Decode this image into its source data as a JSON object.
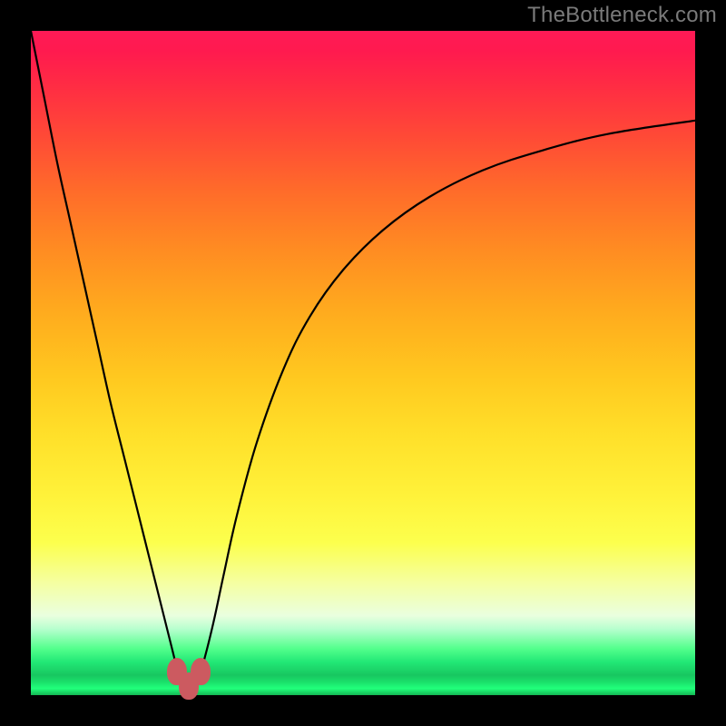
{
  "watermark": "TheBottleneck.com",
  "colors": {
    "curve": "#000000",
    "blob": "#cc5a60",
    "frame": "#000000"
  },
  "chart_data": {
    "type": "line",
    "title": "",
    "xlabel": "",
    "ylabel": "",
    "xlim": [
      0,
      100
    ],
    "ylim": [
      0,
      100
    ],
    "grid": false,
    "series": [
      {
        "name": "curve",
        "x": [
          0,
          2,
          4,
          6,
          8,
          10,
          12,
          14,
          16,
          18,
          20,
          21.5,
          22.5,
          23.5,
          25,
          26,
          27.5,
          29,
          31,
          34,
          38,
          42,
          47,
          53,
          60,
          68,
          77,
          87,
          100
        ],
        "y": [
          100,
          90,
          80,
          71,
          62,
          53,
          44,
          36,
          28,
          20,
          12,
          6,
          2,
          1,
          2,
          5,
          11,
          18,
          27,
          38,
          49,
          57,
          64,
          70,
          75,
          79,
          82,
          84.5,
          86.5
        ]
      }
    ],
    "annotations": [
      {
        "type": "blob",
        "x": 22.0,
        "y": 3.5
      },
      {
        "type": "blob",
        "x": 25.5,
        "y": 3.5
      },
      {
        "type": "blob",
        "x": 23.8,
        "y": 1.3
      }
    ]
  }
}
